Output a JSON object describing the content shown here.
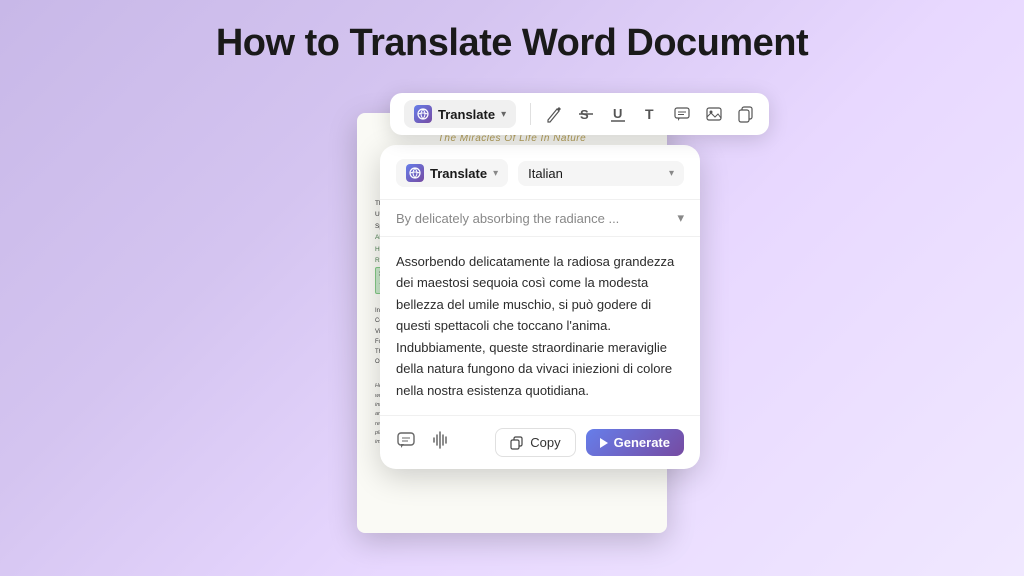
{
  "page": {
    "title": "How to Translate Word Document",
    "background": "#d4c0f0"
  },
  "document": {
    "title": "The Miracles Of Life In Nature",
    "line1": "The Aesthetic Allure Presented By The Vegetation Found In The Natural World Is Truly",
    "line2": "Unparalleled. One Cannot Help But Marvel At The Exquisite Cherry",
    "line3": "Springs Or The Vivid Hues That Drench Maple Leaves During Autu",
    "line4green": "Absorbing The Radiance Of Towering Sequoias As Well As The Um",
    "line5green": "Humble Moss. One May Bask In These Soul-Stirring Spectacles: Un",
    "line6green": "Remarkable Wonders Of Nature Serve As Vibrant Injections Of Col",
    "highlight": "私たちの自然の中において、自然の美しくある\n環境を豊かな活力に満ちた刺激を提供します。",
    "para1": "In Essence, Plants Assume A Momentous Role Within Our Lives In",
    "para2": "Companions. They Silently Offer Solace, Instilling Us With Boundles",
    "para3": "Vigor. Grasping The Invaluable Essence Of Our Surroundings, It Bec",
    "para4": "For Us To Cherish Every Thriving Tree Or Blossom And Ensure Thei",
    "para5": "Through Safeguarding Their Existence Can We Continue To Flourish",
    "para6": "Our Lives Would Be Rendered Functionless.",
    "footer1": "He is renowned for studying the flora of the natural world. She",
    "footer2": "writes in plant classification, Kentture, and ecology and",
    "footer3": "internationally recognized to teaches at multiple universities",
    "footer4": "and shares his knowledge and passion for nature with young",
    "footer5": "researchers. He is fascinated by the diversity and beauty of",
    "footer6": "plants, and continues his writing activities to convey the",
    "footer7": "importance of nature to people."
  },
  "toolbar": {
    "translate_label": "Translate",
    "chevron": "▾",
    "icon_pen": "✏",
    "icon_strike": "S",
    "icon_underline": "U",
    "icon_text": "T",
    "icon_comment": "💬",
    "icon_image": "🖼",
    "icon_copy": "⎘"
  },
  "translate_panel": {
    "translate_label": "Translate",
    "chevron": "▾",
    "lang_label": "Italian",
    "lang_chevron": "▾",
    "source_text": "By delicately absorbing the radiance ...",
    "source_chevron": "▾",
    "translated_text": "Assorbendo delicatamente la radiosa grandezza dei maestosi sequoia così come la modesta bellezza del umile muschio, si può godere di questi spettacoli che toccano l'anima. Indubbiamente, queste straordinarie meraviglie della natura fungono da vivaci iniezioni di colore nella nostra esistenza quotidiana.",
    "copy_label": "Copy",
    "generate_label": "Generate"
  }
}
